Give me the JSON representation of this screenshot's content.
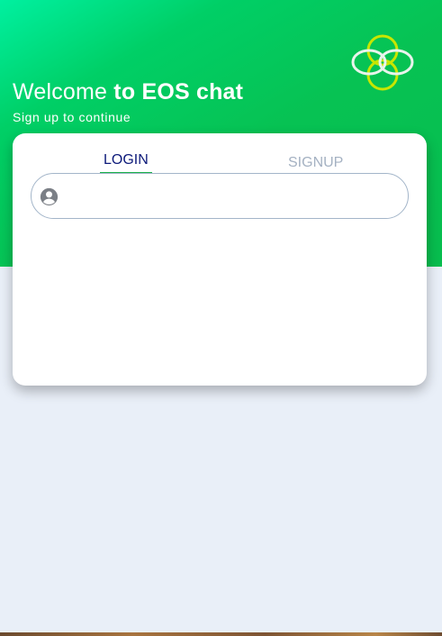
{
  "hero": {
    "welcome_light": "Welcome",
    "welcome_bold": "to EOS chat",
    "subtitle": "Sign up to continue"
  },
  "tabs": [
    {
      "label": "LOGIN",
      "active": true
    },
    {
      "label": "SIGNUP",
      "active": false
    }
  ],
  "username_field": {
    "value": "",
    "placeholder": "",
    "icon": "user-circle-icon"
  },
  "colors": {
    "brand_green": "#07c253",
    "active_tab_text": "#0d1a7a",
    "active_tab_underline": "#1ab24a",
    "inactive_tab_text": "#a4b1c2",
    "logo_yellow_green": "#c8e600"
  }
}
